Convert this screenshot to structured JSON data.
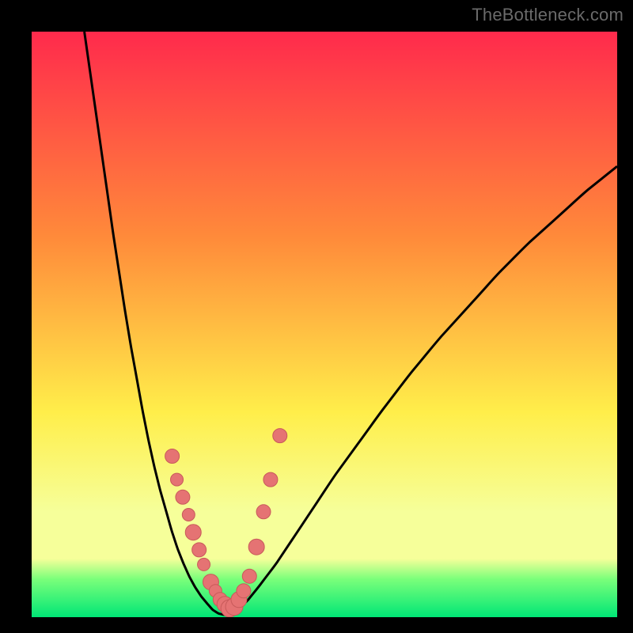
{
  "watermark": {
    "text": "TheBottleneck.com"
  },
  "colors": {
    "frame": "#000000",
    "curve": "#000000",
    "marker_fill": "#e57373",
    "marker_stroke": "#c85a5a",
    "gradient_top": "#ff2a4c",
    "gradient_mid1": "#ff8a3a",
    "gradient_mid2": "#ffee4a",
    "gradient_band": "#f6ff9a",
    "gradient_green1": "#7aff7a",
    "gradient_green2": "#00e676",
    "watermark": "#6a6a6a"
  },
  "chart_data": {
    "type": "line",
    "title": "",
    "xlabel": "",
    "ylabel": "",
    "xlim": [
      0,
      100
    ],
    "ylim": [
      0,
      100
    ],
    "grid": false,
    "legend": false,
    "note": "Axes unlabeled in source image; values are pixel-derived normalized estimates.",
    "series": [
      {
        "name": "left-curve",
        "x": [
          9,
          10,
          11,
          12,
          13,
          14,
          15,
          16,
          17,
          18,
          19,
          20,
          21,
          22,
          23,
          24,
          25,
          26,
          27,
          28,
          29,
          30
        ],
        "y": [
          100,
          93,
          86,
          79,
          72,
          65,
          58.5,
          52,
          46,
          40.5,
          35,
          30,
          25.5,
          21.5,
          18,
          14.5,
          11.5,
          9,
          6.8,
          5,
          3.5,
          2.3
        ]
      },
      {
        "name": "valley",
        "x": [
          30,
          31,
          32,
          33,
          34,
          35
        ],
        "y": [
          2.3,
          1.2,
          0.6,
          0.4,
          0.6,
          1.2
        ]
      },
      {
        "name": "right-curve",
        "x": [
          35,
          37,
          39,
          42,
          45,
          48,
          52,
          56,
          60,
          65,
          70,
          75,
          80,
          85,
          90,
          95,
          100
        ],
        "y": [
          1.2,
          3.0,
          5.5,
          9.5,
          14.0,
          18.5,
          24.5,
          30.0,
          35.5,
          42.0,
          48.0,
          53.5,
          59.0,
          64.0,
          68.5,
          73.0,
          77.0
        ]
      }
    ],
    "markers": [
      {
        "name": "left-branch-dots",
        "x": [
          24.0,
          24.8,
          25.8,
          26.8,
          27.6,
          28.6,
          29.4,
          30.6,
          31.4,
          32.2,
          33.0,
          33.8
        ],
        "y": [
          27.5,
          23.5,
          20.5,
          17.5,
          14.5,
          11.5,
          9.0,
          6.0,
          4.5,
          3.0,
          2.2,
          1.5
        ],
        "r": [
          9,
          8,
          9,
          8,
          10,
          9,
          8,
          10,
          8,
          9,
          10,
          11
        ]
      },
      {
        "name": "right-branch-dots",
        "x": [
          34.6,
          35.4,
          36.2,
          37.2,
          38.4,
          39.6,
          40.8,
          42.4
        ],
        "y": [
          1.8,
          3.0,
          4.5,
          7.0,
          12.0,
          18.0,
          23.5,
          31.0
        ],
        "r": [
          11,
          10,
          9,
          9,
          10,
          9,
          9,
          9
        ]
      }
    ]
  }
}
